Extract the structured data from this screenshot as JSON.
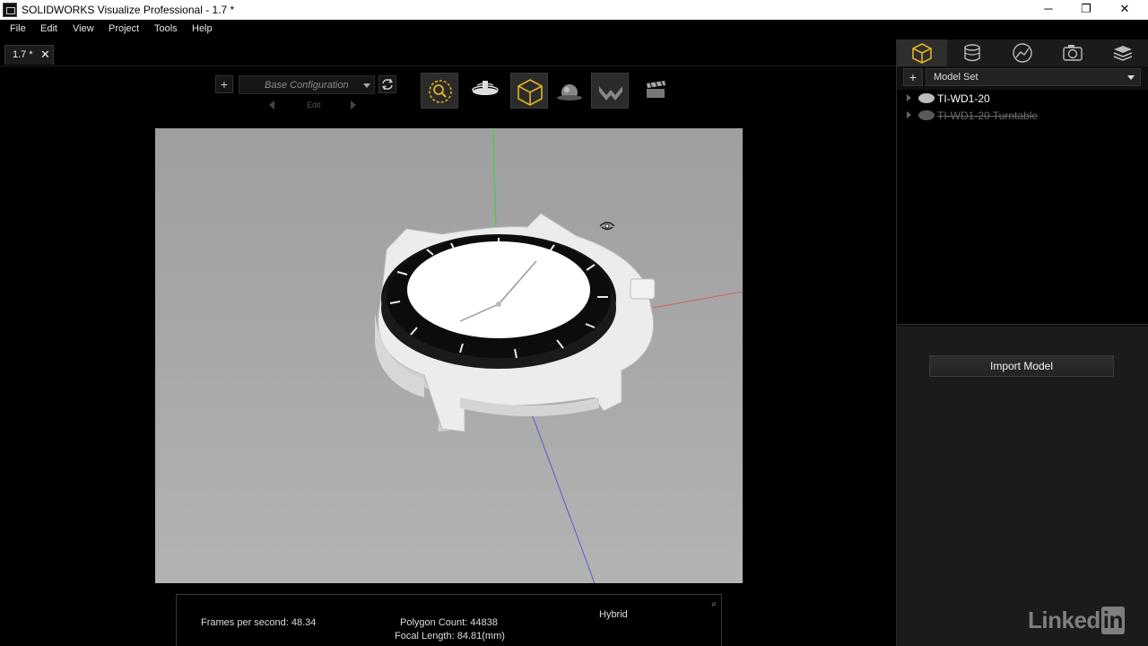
{
  "window": {
    "title": "SOLIDWORKS Visualize Professional - 1.7 *",
    "minimize": "─",
    "restore": "❐",
    "close": "✕"
  },
  "menu": [
    "File",
    "Edit",
    "View",
    "Project",
    "Tools",
    "Help"
  ],
  "doc_tab": {
    "label": "1.7 *",
    "close": "✕"
  },
  "toolbar": {
    "add": "+",
    "configuration": "Base Configuration",
    "edit_label": "Edit",
    "tools": [
      "zoom-tool-icon",
      "turntable-icon",
      "cube-view-icon",
      "sphere-tool-icon",
      "flip-tool-icon",
      "clapper-icon"
    ]
  },
  "status": {
    "fps": "Frames per second: 48.34",
    "polygons": "Polygon Count: 44838",
    "focal": "Focal Length: 84.81(mm)",
    "mode": "Hybrid"
  },
  "right_panel": {
    "tabs": [
      "models-tab-icon",
      "appearances-tab-icon",
      "scenes-tab-icon",
      "cameras-tab-icon",
      "libraries-tab-icon"
    ],
    "add": "+",
    "model_set": "Model Set",
    "models": [
      {
        "name": "TI-WD1-20",
        "hidden": false
      },
      {
        "name": "TI-WD1-20 Turntable",
        "hidden": true
      }
    ],
    "import_button": "Import Model"
  },
  "watermark": {
    "linked": "Linked",
    "in": "in"
  },
  "colors": {
    "accent": "#e3b321",
    "viewport_bg": "#a8a8a8",
    "panel_bg": "#1b1b1b"
  }
}
